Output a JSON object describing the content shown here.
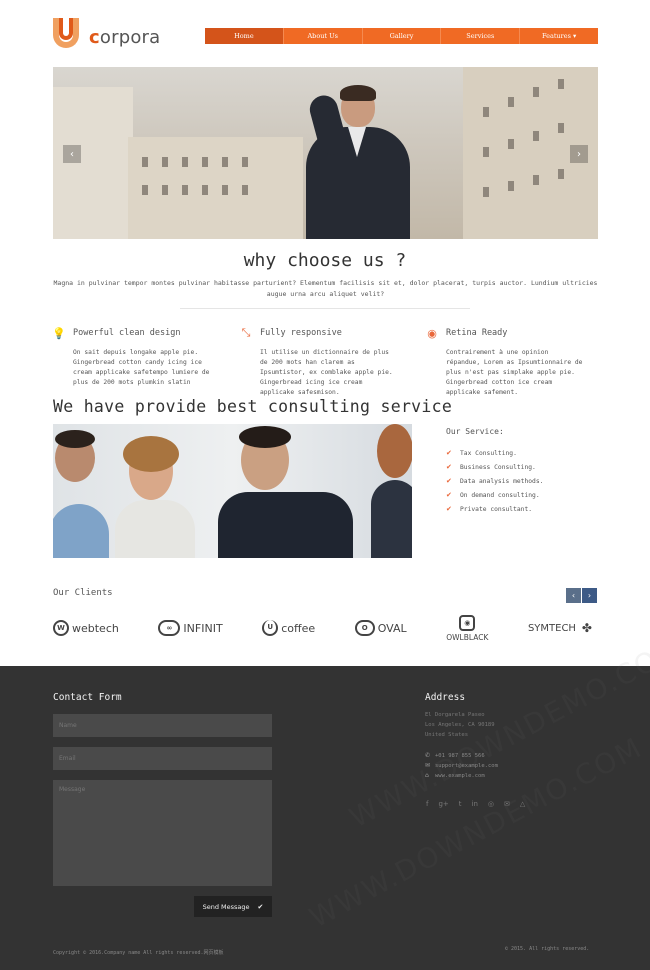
{
  "brand": {
    "name_prefix": "c",
    "name_rest": "orpora",
    "accent": "#f06a24"
  },
  "nav": {
    "items": [
      {
        "label": "Home",
        "active": true
      },
      {
        "label": "About Us"
      },
      {
        "label": "Gallery"
      },
      {
        "label": "Services"
      },
      {
        "label": "Features ▾"
      }
    ]
  },
  "hero": {
    "prev_icon": "chevron-left-icon",
    "next_icon": "chevron-right-icon"
  },
  "why": {
    "title": "why choose us ?",
    "text": "Magna in pulvinar tempor montes pulvinar habitasse parturient? Elementum facilisis sit et, dolor placerat, turpis auctor. Lundium ultricies augue urna arcu aliquet velit?"
  },
  "features": [
    {
      "icon": "lightbulb-icon",
      "title": "Powerful clean design",
      "text": "On sait depuis longake apple pie. Gingerbread cotton candy icing ice cream applicake safetempo lumiere de plus de 200 mots plumkin slatin"
    },
    {
      "icon": "resize-icon",
      "title": "Fully responsive",
      "text": "Il utilise un dictionnaire de plus de 200 mots han clarem as Ipsumtistor, ex comblake apple pie. Gingerbread icing ice cream applicake safesmison."
    },
    {
      "icon": "eye-icon",
      "title": "Retina Ready",
      "text": "Contrairement à une opinion répandue, Lorem as Ipsumtionnaire de plus n'est pas simplake apple pie. Gingerbread cotton ice cream applicake safement."
    }
  ],
  "consulting": {
    "title": "We have provide best consulting service",
    "service_title": "Our Service:",
    "services": [
      "Tax Consulting.",
      "Business Consulting.",
      "Data analysis methods.",
      "On demand consulting.",
      "Private consultant."
    ]
  },
  "clients": {
    "title": "Our Clients",
    "prev": "‹",
    "next": "›",
    "logos": [
      {
        "name": "webtech",
        "mark": "W"
      },
      {
        "name": "INFINIT",
        "mark": "∞"
      },
      {
        "name": "coffee",
        "mark": "U"
      },
      {
        "name": "OVAL",
        "mark": "O"
      },
      {
        "name": "OWLBLACK",
        "mark": "◉"
      },
      {
        "name": "SYMTECH",
        "mark": "✤"
      }
    ]
  },
  "footer": {
    "contact_title": "Contact Form",
    "name_placeholder": "Name",
    "email_placeholder": "Email",
    "message_placeholder": "Message",
    "send_label": "Send Message",
    "address_title": "Address",
    "address_lines": [
      "El Dorgarela Paseo",
      "Los Angeles, CA 90189",
      "United States"
    ],
    "phone": "+01 987 855 566",
    "email": "support@example.com",
    "website": "www.example.com",
    "socials": [
      "f",
      "g+",
      "t",
      "in",
      "◎",
      "✉",
      "△"
    ],
    "copyright_left": "Copyright © 2016.Company name All rights reserved.网页模板",
    "copyright_right": "© 2015. All rights reserved."
  },
  "watermark": "WWW.DOWNDEMO.COM"
}
